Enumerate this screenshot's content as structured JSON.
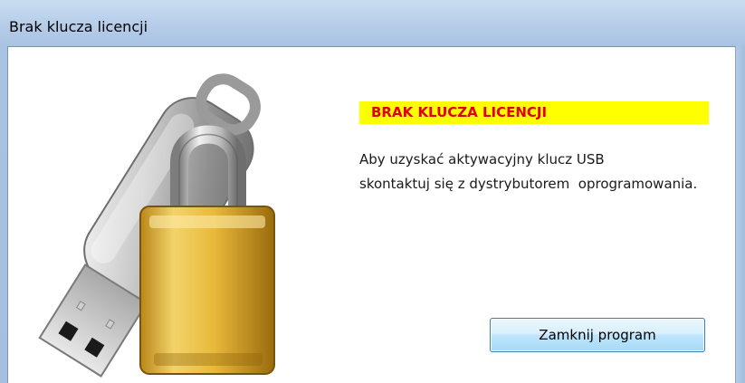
{
  "window": {
    "title": "Brak klucza licencji"
  },
  "banner": {
    "text": "BRAK KLUCZA LICENCJI",
    "background_color": "#ffff00",
    "text_color": "#e00000"
  },
  "message": {
    "line1": "Aby uzyskać aktywacyjny klucz USB",
    "line2": "skontaktuj się z dystrybutorem  oprogramowania."
  },
  "buttons": {
    "close_label": "Zamknij program"
  },
  "icons": {
    "illustration": "usb-key-padlock-icon"
  }
}
